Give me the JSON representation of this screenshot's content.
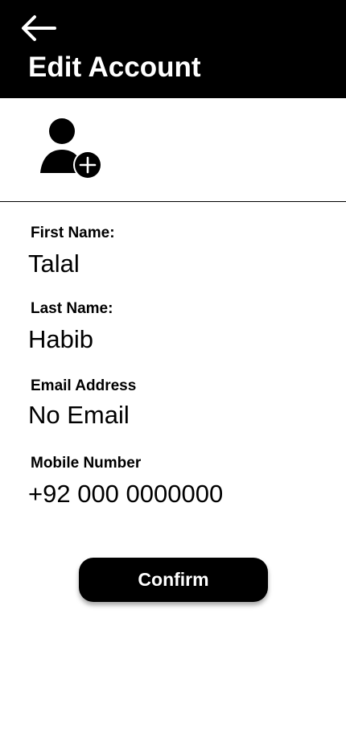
{
  "header": {
    "title": "Edit Account",
    "back_icon": "arrow-left-icon"
  },
  "avatar": {
    "icon": "add-user-icon"
  },
  "fields": {
    "first_name": {
      "label": "First Name:",
      "value": "Talal"
    },
    "last_name": {
      "label": "Last Name:",
      "value": "Habib"
    },
    "email": {
      "label": "Email Address",
      "value": "No Email"
    },
    "mobile": {
      "label": "Mobile Number",
      "value": "+92 000 0000000"
    }
  },
  "actions": {
    "confirm_label": "Confirm"
  },
  "colors": {
    "header_bg": "#000000",
    "header_text": "#ffffff",
    "page_bg": "#ffffff",
    "button_bg": "#000000",
    "button_text": "#ffffff"
  }
}
